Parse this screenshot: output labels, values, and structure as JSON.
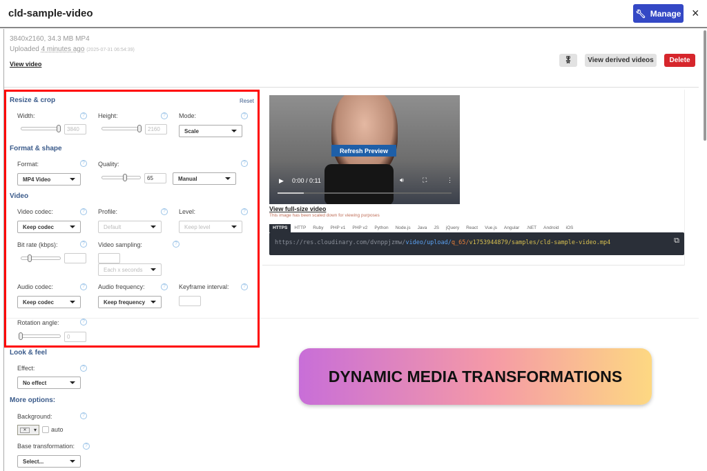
{
  "header": {
    "title": "cld-sample-video",
    "manage_label": "Manage",
    "close_icon": "×"
  },
  "asset": {
    "dimensions": "3840x2160, 34.3 MB MP4",
    "uploaded_prefix": "Uploaded",
    "uploaded_relative": "4 minutes ago",
    "uploaded_timestamp": "(2025-07-31 06:54:39)",
    "view_video": "View video"
  },
  "actions": {
    "view_derived": "View derived videos",
    "delete": "Delete"
  },
  "resize": {
    "title": "Resize & crop",
    "reset": "Reset",
    "width_label": "Width:",
    "width_value": "3840",
    "width_fraction": 1.0,
    "height_label": "Height:",
    "height_value": "2160",
    "height_fraction": 1.0,
    "mode_label": "Mode:",
    "mode_value": "Scale"
  },
  "format": {
    "title": "Format & shape",
    "format_label": "Format:",
    "format_value": "MP4 Video",
    "quality_label": "Quality:",
    "quality_value": "65",
    "quality_fraction": 0.6,
    "quality_mode": "Manual"
  },
  "video": {
    "title": "Video",
    "codec_label": "Video codec:",
    "codec_value": "Keep codec",
    "profile_label": "Profile:",
    "profile_value": "Default",
    "level_label": "Level:",
    "level_value": "Keep level",
    "bitrate_label": "Bit rate (kbps):",
    "bitrate_fraction": 0.2,
    "sampling_label": "Video sampling:",
    "sampling_mode": "Each x seconds",
    "audio_codec_label": "Audio codec:",
    "audio_codec_value": "Keep codec",
    "audio_freq_label": "Audio frequency:",
    "audio_freq_value": "Keep frequency",
    "keyframe_label": "Keyframe interval:",
    "rotation_label": "Rotation angle:",
    "rotation_value": "0",
    "rotation_fraction": 0
  },
  "look": {
    "title": "Look & feel",
    "effect_label": "Effect:",
    "effect_value": "No effect"
  },
  "more": {
    "title": "More options:",
    "background_label": "Background:",
    "auto_label": "auto",
    "base_label": "Base transformation:",
    "base_value": "Select..."
  },
  "preview": {
    "refresh": "Refresh Preview",
    "time": "0:00 / 0:11",
    "progress": 0.15,
    "view_full": "View full-size video",
    "note": "This image has been scaled down for viewing purposes"
  },
  "code": {
    "tabs": [
      "HTTPS",
      "HTTP",
      "Ruby",
      "PHP v1",
      "PHP v2",
      "Python",
      "Node.js",
      "Java",
      "JS",
      "jQuery",
      "React",
      "Vue.js",
      "Angular",
      ".NET",
      "Android",
      "iOS"
    ],
    "url_base": "https://res.cloudinary.com/dvnppjzmw/",
    "url_path": "video/upload/",
    "url_transform": "q_65/",
    "url_rest": "v1753944879/samples/cld-sample-video.mp4"
  },
  "banner": {
    "text": "DYNAMIC MEDIA TRANSFORMATIONS"
  }
}
